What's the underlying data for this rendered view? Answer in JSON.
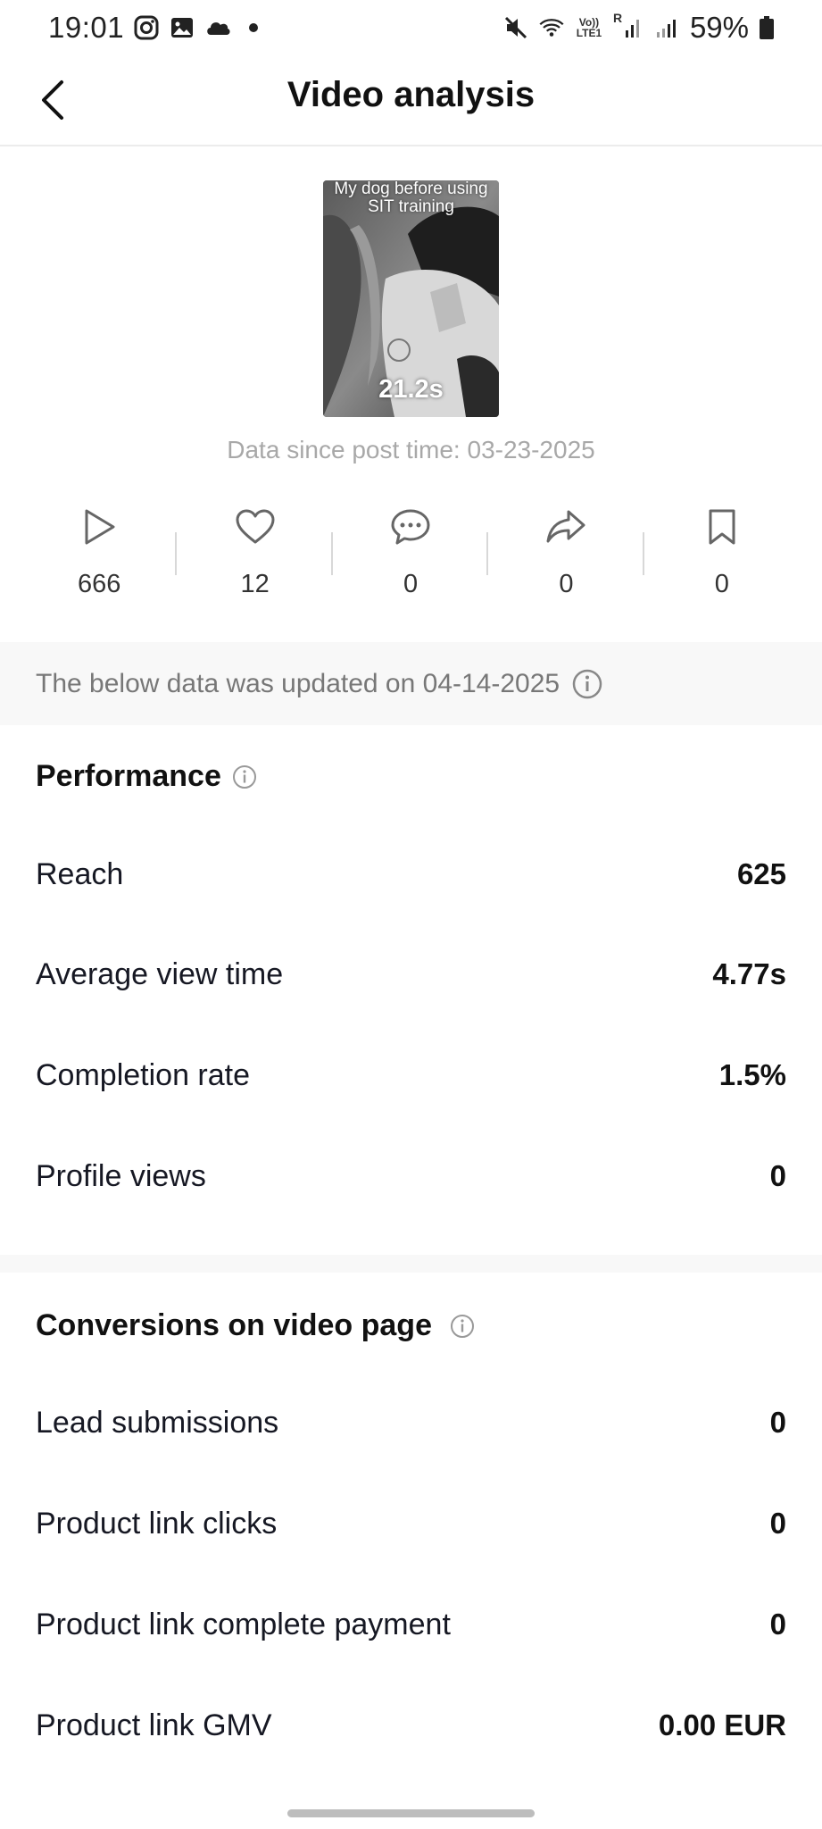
{
  "status_bar": {
    "time": "19:01",
    "left_icons": [
      "instagram-icon",
      "gallery-icon",
      "cloud-icon",
      "dot-icon"
    ],
    "right_icons": [
      "mute-icon",
      "wifi-icon",
      "volte-icon",
      "signal-icon",
      "signal-icon",
      "battery-icon"
    ],
    "volte_line1": "Vo))",
    "volte_line2": "LTE1",
    "roaming": "R",
    "battery_percent": "59%"
  },
  "header": {
    "title": "Video analysis",
    "back_icon": "chevron-left-icon"
  },
  "video": {
    "caption": "My dog before using SIT training",
    "duration": "21.2s",
    "post_time": "Data since post time: 03-23-2025"
  },
  "stats": [
    {
      "icon": "play-icon",
      "value": "666"
    },
    {
      "icon": "heart-icon",
      "value": "12"
    },
    {
      "icon": "comment-icon",
      "value": "0"
    },
    {
      "icon": "share-icon",
      "value": "0"
    },
    {
      "icon": "bookmark-icon",
      "value": "0"
    }
  ],
  "update_banner": {
    "text": "The below data was updated on 04-14-2025"
  },
  "performance": {
    "title": "Performance",
    "rows": [
      {
        "label": "Reach",
        "value": "625"
      },
      {
        "label": "Average view time",
        "value": "4.77s"
      },
      {
        "label": "Completion rate",
        "value": "1.5%"
      },
      {
        "label": "Profile views",
        "value": "0"
      }
    ]
  },
  "conversions": {
    "title": "Conversions on video page",
    "rows": [
      {
        "label": "Lead submissions",
        "value": "0"
      },
      {
        "label": "Product link clicks",
        "value": "0"
      },
      {
        "label": "Product link complete payment",
        "value": "0"
      },
      {
        "label": "Product link GMV",
        "value": "0.00 EUR"
      }
    ]
  }
}
